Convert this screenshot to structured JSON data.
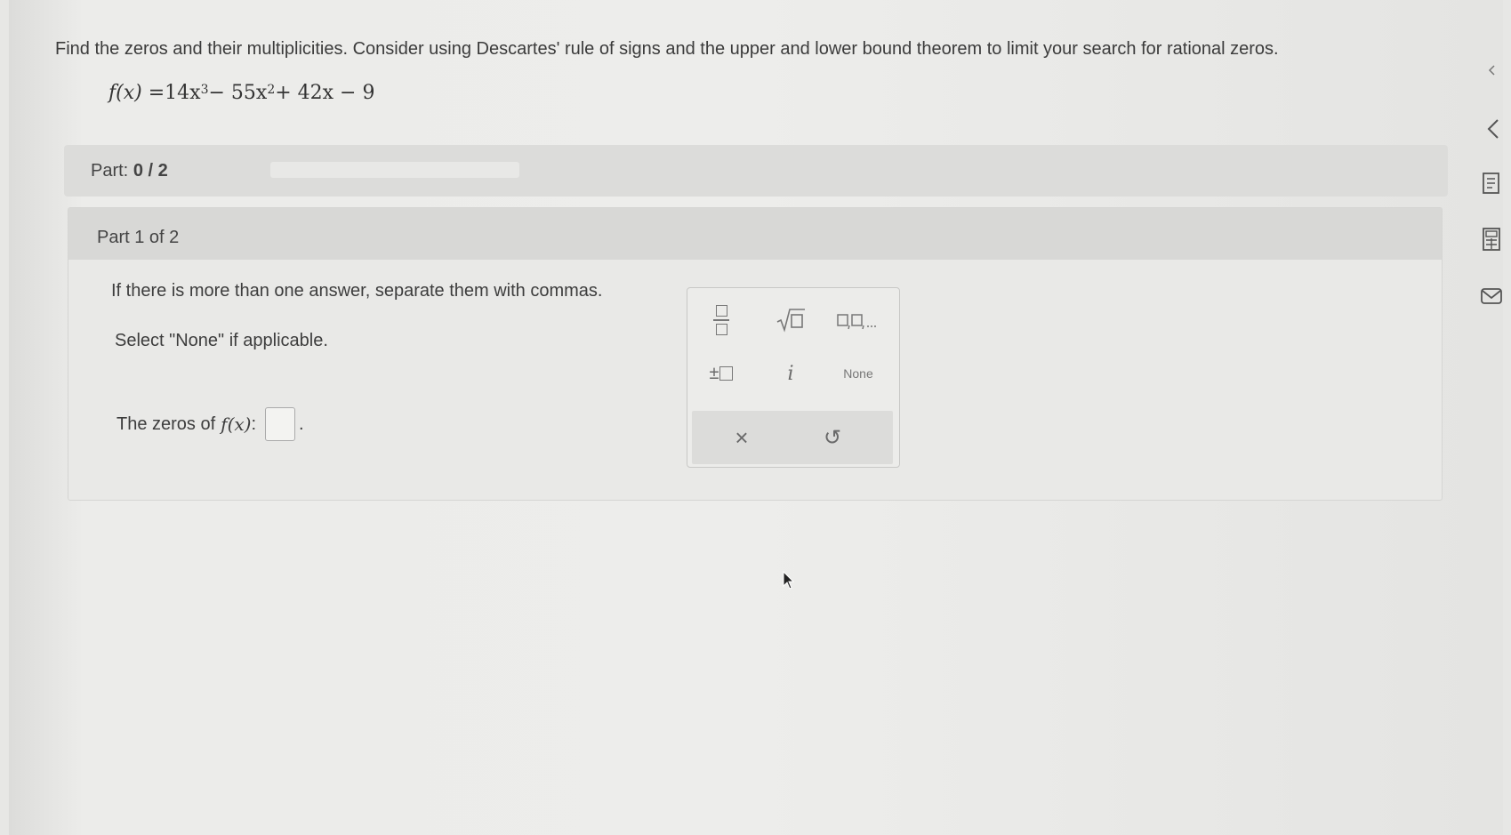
{
  "question": "Find the zeros and their multiplicities. Consider using Descartes' rule of signs and the upper and lower bound theorem to limit your search for rational zeros.",
  "formula": {
    "lhs": "f(x) = ",
    "t1": "14x",
    "e1": "3",
    "t2": " − 55x",
    "e2": "2",
    "t3": " + 42x − 9"
  },
  "part_progress": {
    "label": "Part:",
    "value": "0 / 2",
    "fraction": 0
  },
  "part": {
    "title": "Part 1 of 2",
    "instruction_1": "If there is more than one answer, separate them with commas.",
    "instruction_2": "Select \"None\" if applicable.",
    "zeros_label": "The zeros of",
    "fx": "f(x)",
    "colon": ":",
    "period": "."
  },
  "keypad": {
    "none_label": "None",
    "i_label": "i",
    "plusminus": "±",
    "clear_symbol": "×",
    "undo_symbol": "↺"
  },
  "icons": [
    "fraction-icon",
    "sqrt-icon",
    "list-icon",
    "plusminus-icon",
    "imaginary-i-icon",
    "none-icon",
    "clear-icon",
    "undo-icon",
    "collapse-chevron-icon",
    "worksheet-icon",
    "calculator-icon",
    "mail-icon",
    "pointer-cursor-icon"
  ]
}
